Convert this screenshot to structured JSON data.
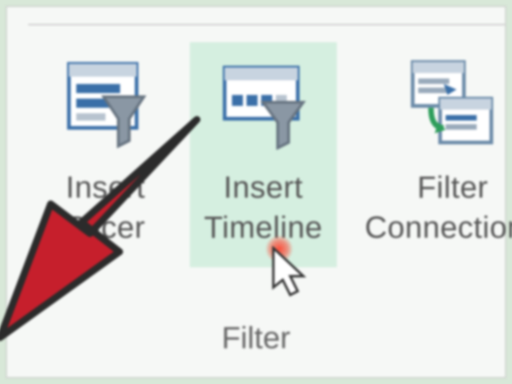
{
  "ribbon": {
    "group_label": "Filter",
    "buttons": {
      "insert_slicer": {
        "label_line1": "Insert",
        "label_line2": "Slicer",
        "icon": "slicer-icon"
      },
      "insert_timeline": {
        "label_line1": "Insert",
        "label_line2": "Timeline",
        "icon": "timeline-icon"
      },
      "filter_connections": {
        "label_line1": "Filter",
        "label_line2": "Connections",
        "icon": "filter-connections-icon"
      }
    }
  },
  "annotations": {
    "arrow_color": "#c61f2c",
    "arrow_stroke": "#2b2b2b",
    "laser_color": "#ff3c28"
  }
}
